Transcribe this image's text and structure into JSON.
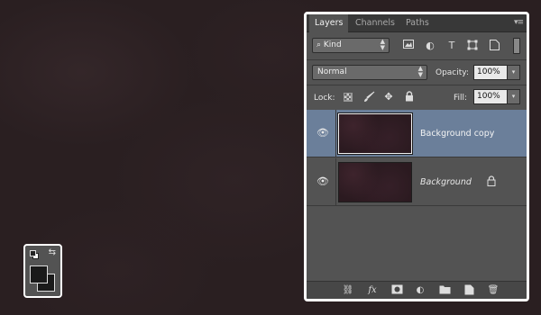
{
  "tools": {
    "swap_glyph": "⇆",
    "foreground_color": "#1a1a1a",
    "background_color": "#1a1a1a"
  },
  "panel": {
    "tabs": [
      {
        "label": "Layers",
        "active": true
      },
      {
        "label": "Channels",
        "active": false
      },
      {
        "label": "Paths",
        "active": false
      }
    ],
    "menu_glyph": "▾≡",
    "filter": {
      "kind_label": "Kind",
      "arrows": "⇕"
    },
    "blend": {
      "mode": "Normal",
      "opacity_label": "Opacity:",
      "opacity_value": "100%"
    },
    "lock": {
      "lock_label": "Lock:",
      "fill_label": "Fill:",
      "fill_value": "100%"
    },
    "layers": [
      {
        "name": "Background copy",
        "selected": true,
        "visible": true,
        "locked": false
      },
      {
        "name": "Background",
        "selected": false,
        "visible": true,
        "locked": true
      }
    ],
    "colors": {
      "panel_bg": "#535353",
      "selection": "#6b7f9a",
      "canvas_bg": "#2a1f21"
    }
  }
}
